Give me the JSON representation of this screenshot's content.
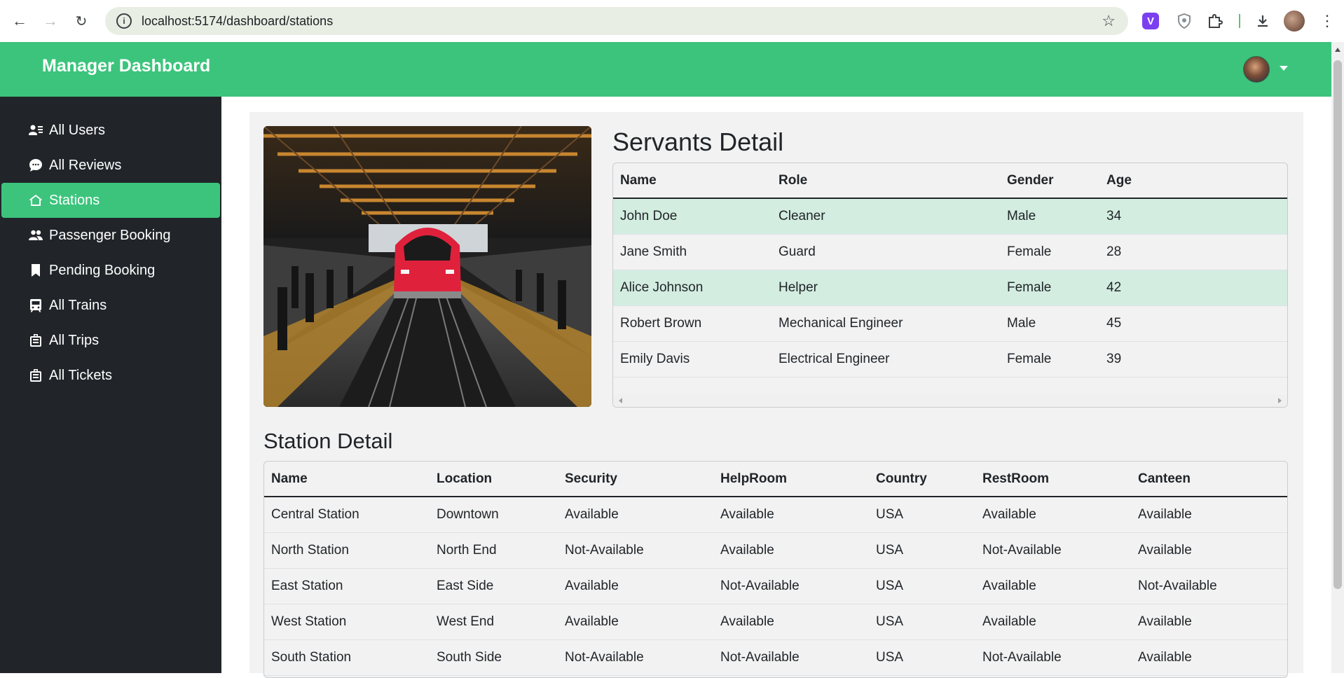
{
  "browser": {
    "url": "localhost:5174/dashboard/stations",
    "extension_v_label": "V"
  },
  "header": {
    "title": "Manager Dashboard"
  },
  "sidebar": {
    "items": [
      {
        "label": "All Users",
        "icon": "users-list-icon"
      },
      {
        "label": "All Reviews",
        "icon": "chat-icon"
      },
      {
        "label": "Stations",
        "icon": "house-icon",
        "active": true
      },
      {
        "label": "Passenger Booking",
        "icon": "people-icon"
      },
      {
        "label": "Pending Booking",
        "icon": "bookmark-icon"
      },
      {
        "label": "All Trains",
        "icon": "train-icon"
      },
      {
        "label": "All Trips",
        "icon": "luggage-icon"
      },
      {
        "label": "All Tickets",
        "icon": "luggage-icon"
      }
    ]
  },
  "servants": {
    "title": "Servants Detail",
    "columns": [
      "Name",
      "Role",
      "Gender",
      "Age"
    ],
    "rows": [
      [
        "John Doe",
        "Cleaner",
        "Male",
        "34"
      ],
      [
        "Jane Smith",
        "Guard",
        "Female",
        "28"
      ],
      [
        "Alice Johnson",
        "Helper",
        "Female",
        "42"
      ],
      [
        "Robert Brown",
        "Mechanical Engineer",
        "Male",
        "45"
      ],
      [
        "Emily Davis",
        "Electrical Engineer",
        "Female",
        "39"
      ]
    ]
  },
  "stations": {
    "title": "Station Detail",
    "columns": [
      "Name",
      "Location",
      "Security",
      "HelpRoom",
      "Country",
      "RestRoom",
      "Canteen"
    ],
    "rows": [
      [
        "Central Station",
        "Downtown",
        "Available",
        "Available",
        "USA",
        "Available",
        "Available"
      ],
      [
        "North Station",
        "North End",
        "Not-Available",
        "Available",
        "USA",
        "Not-Available",
        "Available"
      ],
      [
        "East Station",
        "East Side",
        "Available",
        "Not-Available",
        "USA",
        "Available",
        "Not-Available"
      ],
      [
        "West Station",
        "West End",
        "Available",
        "Available",
        "USA",
        "Available",
        "Available"
      ],
      [
        "South Station",
        "South Side",
        "Not-Available",
        "Not-Available",
        "USA",
        "Not-Available",
        "Available"
      ]
    ]
  },
  "colors": {
    "brand": "#3cc47c",
    "sidebar_bg": "#212529",
    "striped_row": "#d3ede0"
  }
}
